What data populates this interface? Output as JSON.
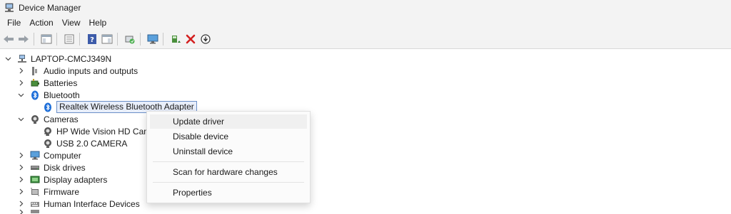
{
  "window": {
    "title": "Device Manager"
  },
  "menubar": {
    "items": [
      "File",
      "Action",
      "View",
      "Help"
    ]
  },
  "toolbar": {
    "buttons": [
      "back-arrow-icon",
      "forward-arrow-icon",
      "show-hide-console-tree-icon",
      "properties-icon",
      "help-icon",
      "details-pane-icon",
      "scan-hardware-icon",
      "monitor-icon",
      "update-driver-icon",
      "uninstall-device-icon",
      "disable-device-icon"
    ]
  },
  "tree": {
    "root": "LAPTOP-CMCJ349N",
    "nodes": [
      {
        "label": "Audio inputs and outputs",
        "icon": "speaker-icon"
      },
      {
        "label": "Batteries",
        "icon": "battery-icon"
      },
      {
        "label": "Bluetooth",
        "icon": "bluetooth-icon"
      },
      {
        "label": "Realtek Wireless Bluetooth Adapter",
        "icon": "bluetooth-icon"
      },
      {
        "label": "Cameras",
        "icon": "camera-icon"
      },
      {
        "label": "HP Wide Vision HD Came",
        "icon": "camera-icon"
      },
      {
        "label": "USB 2.0 CAMERA",
        "icon": "camera-icon"
      },
      {
        "label": "Computer",
        "icon": "monitor-icon"
      },
      {
        "label": "Disk drives",
        "icon": "disk-drive-icon"
      },
      {
        "label": "Display adapters",
        "icon": "display-adapter-icon"
      },
      {
        "label": "Firmware",
        "icon": "firmware-icon"
      },
      {
        "label": "Human Interface Devices",
        "icon": "hid-icon"
      }
    ]
  },
  "context_menu": {
    "items": [
      {
        "label": "Update driver"
      },
      {
        "label": "Disable device"
      },
      {
        "label": "Uninstall device"
      },
      {
        "label": "Scan for hardware changes"
      },
      {
        "label": "Properties"
      }
    ]
  },
  "colors": {
    "chrome_bg": "#f3f3f3",
    "selection_border": "#6b8fc7",
    "selection_bg": "#e8eefa",
    "bluetooth_blue": "#1e6fd9",
    "red_x": "#d32020"
  }
}
